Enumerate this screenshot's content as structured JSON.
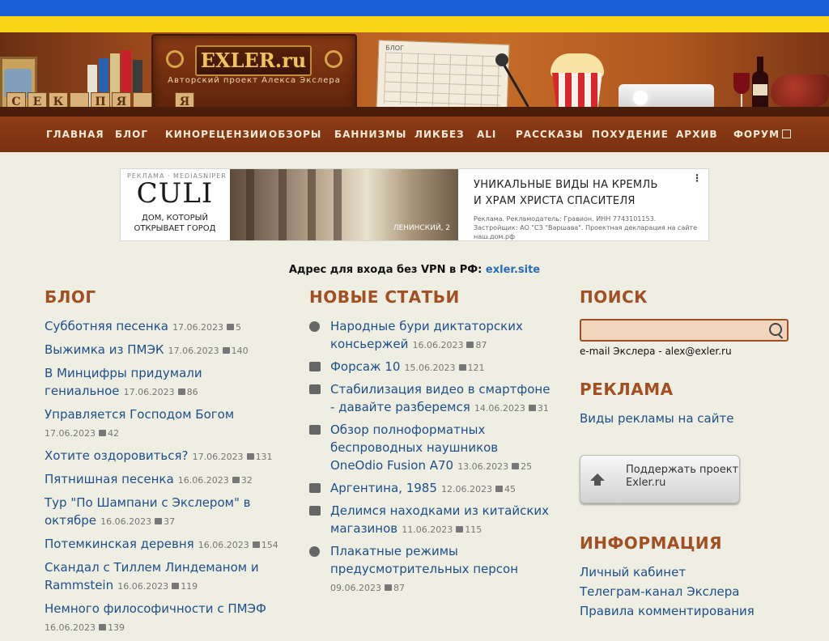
{
  "header": {
    "logo": "EXLER.ru",
    "subtitle": "Авторский проект Алекса Экслера",
    "tiles": [
      "С",
      "Е",
      "К",
      "",
      "П",
      "Я",
      "",
      "Я"
    ],
    "calendar_label": "БЛОГ"
  },
  "nav": {
    "items": [
      "ГЛАВНАЯ",
      "БЛОГ",
      "КИНОРЕЦЕНЗИИ",
      "ОБЗОРЫ",
      "БАННИЗМЫ",
      "ЛИКБЕЗ",
      "ALI",
      "РАССКАЗЫ",
      "ПОХУДЕНИЕ",
      "АРХИВ",
      "ФОРУМ"
    ]
  },
  "ad": {
    "tag": "РЕКЛАМА · MEDIASNIPER",
    "brand": "CULI",
    "slogan_1": "ДОМ, КОТОРЫЙ",
    "slogan_2": "ОТКРЫВАЕТ ГОРОД",
    "photo_caption": "ЛЕНИНСКИЙ, 2",
    "headline_1": "УНИКАЛЬНЫЕ ВИДЫ НА КРЕМЛЬ",
    "headline_2": "И ХРАМ ХРИСТА СПАСИТЕЛЯ",
    "fine_print": "Реклама. Рекламодатель: Гравион. ИНН 7743101153. Застройщик: АО \"СЗ \"Варшава\". Проектная декларация на сайте наш.дом.рф",
    "menu": "⋮"
  },
  "vpn": {
    "text": "Адрес для входа без VPN в РФ:",
    "link": "exler.site"
  },
  "blog": {
    "title": "БЛОГ",
    "items": [
      {
        "title": "Субботняя песенка",
        "date": "17.06.2023",
        "comments": "5"
      },
      {
        "title": "Выжимка из ПМЭК",
        "date": "17.06.2023",
        "comments": "140"
      },
      {
        "title": "В Минцифры придумали гениальное",
        "date": "17.06.2023",
        "comments": "86"
      },
      {
        "title": "Управляется Господом Богом",
        "date": "17.06.2023",
        "comments": "42"
      },
      {
        "title": "Хотите оздоровиться?",
        "date": "17.06.2023",
        "comments": "131"
      },
      {
        "title": "Пятнишная песенка",
        "date": "16.06.2023",
        "comments": "32"
      },
      {
        "title": "Тур \"По Шампани с Экслером\" в октябре",
        "date": "16.06.2023",
        "comments": "37"
      },
      {
        "title": "Потемкинская деревня",
        "date": "16.06.2023",
        "comments": "154"
      },
      {
        "title": "Скандал с Тиллем Линдеманом и Rammstein",
        "date": "16.06.2023",
        "comments": "119"
      },
      {
        "title": "Немного философичности с ПМЭФ",
        "date": "16.06.2023",
        "comments": "139"
      }
    ]
  },
  "news": {
    "title": "НОВЫЕ СТАТЬИ",
    "items": [
      {
        "icon": "smiley-icon",
        "title": "Народные бури диктаторских консьержей",
        "date": "16.06.2023",
        "comments": "87"
      },
      {
        "icon": "film-icon",
        "title": "Форсаж 10",
        "date": "15.06.2023",
        "comments": "121"
      },
      {
        "icon": "question-icon",
        "title": "Стабилизация видео в смартфоне - давайте разберемся",
        "date": "14.06.2023",
        "comments": "31"
      },
      {
        "icon": "clipboard-icon",
        "title": "Обзор полноформатных беспроводных наушников OneOdio Fusion A70",
        "date": "13.06.2023",
        "comments": "25"
      },
      {
        "icon": "film-icon",
        "title": "Аргентина, 1985",
        "date": "12.06.2023",
        "comments": "45"
      },
      {
        "icon": "question-icon",
        "title": "Делимся находками из китайских магазинов",
        "date": "11.06.2023",
        "comments": "115"
      },
      {
        "icon": "smiley-icon",
        "title": "Плакатные режимы предусмотрительных персон",
        "date": "09.06.2023",
        "comments": "87"
      }
    ]
  },
  "sidebar": {
    "search_title": "ПОИСК",
    "search_value": "",
    "email": "e-mail Экслера - alex@exler.ru",
    "ads_title": "РЕКЛАМА",
    "ads_link": "Виды рекламы на сайте",
    "support_line1": "Поддержать проект",
    "support_line2": "Exler.ru",
    "info_title": "ИНФОРМАЦИЯ",
    "info_links": [
      "Личный кабинет",
      "Телеграм-канал Экслера",
      "Правила комментирования"
    ]
  },
  "colors": {
    "accent": "#a34f24",
    "link": "#1f4f8b",
    "nav_bg": "#8e3c16",
    "page_bg": "#eeeee2"
  }
}
